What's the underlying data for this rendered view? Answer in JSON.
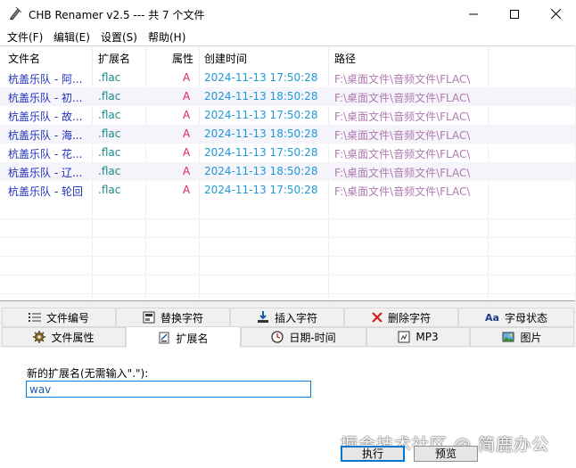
{
  "window": {
    "title": "CHB Renamer v2.5 --- 共 7 个文件"
  },
  "menu": [
    "文件(F)",
    "编辑(E)",
    "设置(S)",
    "帮助(H)"
  ],
  "columns": [
    "文件名",
    "扩展名",
    "属性",
    "创建时间",
    "路径"
  ],
  "files": [
    {
      "name": "杭盖乐队 - 阿...",
      "ext": ".flac",
      "attr": "A",
      "created": "2024-11-13 17:50:28",
      "path": "F:\\桌面文件\\音频文件\\FLAC\\"
    },
    {
      "name": "杭盖乐队 - 初...",
      "ext": ".flac",
      "attr": "A",
      "created": "2024-11-13 18:50:28",
      "path": "F:\\桌面文件\\音频文件\\FLAC\\"
    },
    {
      "name": "杭盖乐队 - 故...",
      "ext": ".flac",
      "attr": "A",
      "created": "2024-11-13 17:50:28",
      "path": "F:\\桌面文件\\音频文件\\FLAC\\"
    },
    {
      "name": "杭盖乐队 - 海...",
      "ext": ".flac",
      "attr": "A",
      "created": "2024-11-13 18:50:28",
      "path": "F:\\桌面文件\\音频文件\\FLAC\\"
    },
    {
      "name": "杭盖乐队 - 花...",
      "ext": ".flac",
      "attr": "A",
      "created": "2024-11-13 17:50:28",
      "path": "F:\\桌面文件\\音频文件\\FLAC\\"
    },
    {
      "name": "杭盖乐队 - 辽...",
      "ext": ".flac",
      "attr": "A",
      "created": "2024-11-13 18:50:28",
      "path": "F:\\桌面文件\\音频文件\\FLAC\\"
    },
    {
      "name": "杭盖乐队 - 轮回",
      "ext": ".flac",
      "attr": "A",
      "created": "2024-11-13 17:50:28",
      "path": "F:\\桌面文件\\音频文件\\FLAC\\"
    }
  ],
  "tabs_row1": [
    {
      "label": "文件编号",
      "icon": "list-number-icon"
    },
    {
      "label": "替换字符",
      "icon": "replace-icon"
    },
    {
      "label": "插入字符",
      "icon": "insert-icon"
    },
    {
      "label": "删除字符",
      "icon": "delete-x-icon"
    },
    {
      "label": "字母状态",
      "icon": "case-icon"
    }
  ],
  "tabs_row2": [
    {
      "label": "文件属性",
      "icon": "gear-icon"
    },
    {
      "label": "扩展名",
      "icon": "extension-icon"
    },
    {
      "label": "日期-时间",
      "icon": "clock-icon"
    },
    {
      "label": "MP3",
      "icon": "music-icon"
    },
    {
      "label": "图片",
      "icon": "picture-icon"
    }
  ],
  "active_tab": "扩展名",
  "extension_panel": {
    "label": "新的扩展名(无需输入\".\"):",
    "value": "wav"
  },
  "buttons": {
    "execute": "执行",
    "preview": "预览"
  },
  "watermark": "掘金技术社区 @ 简鹿办公",
  "colors": {
    "name": "#1f2fb8",
    "ext": "#1a8a8a",
    "attr": "#e0245e",
    "time": "#1e9ad6",
    "path": "#b07ab0",
    "accent": "#0078d7"
  }
}
